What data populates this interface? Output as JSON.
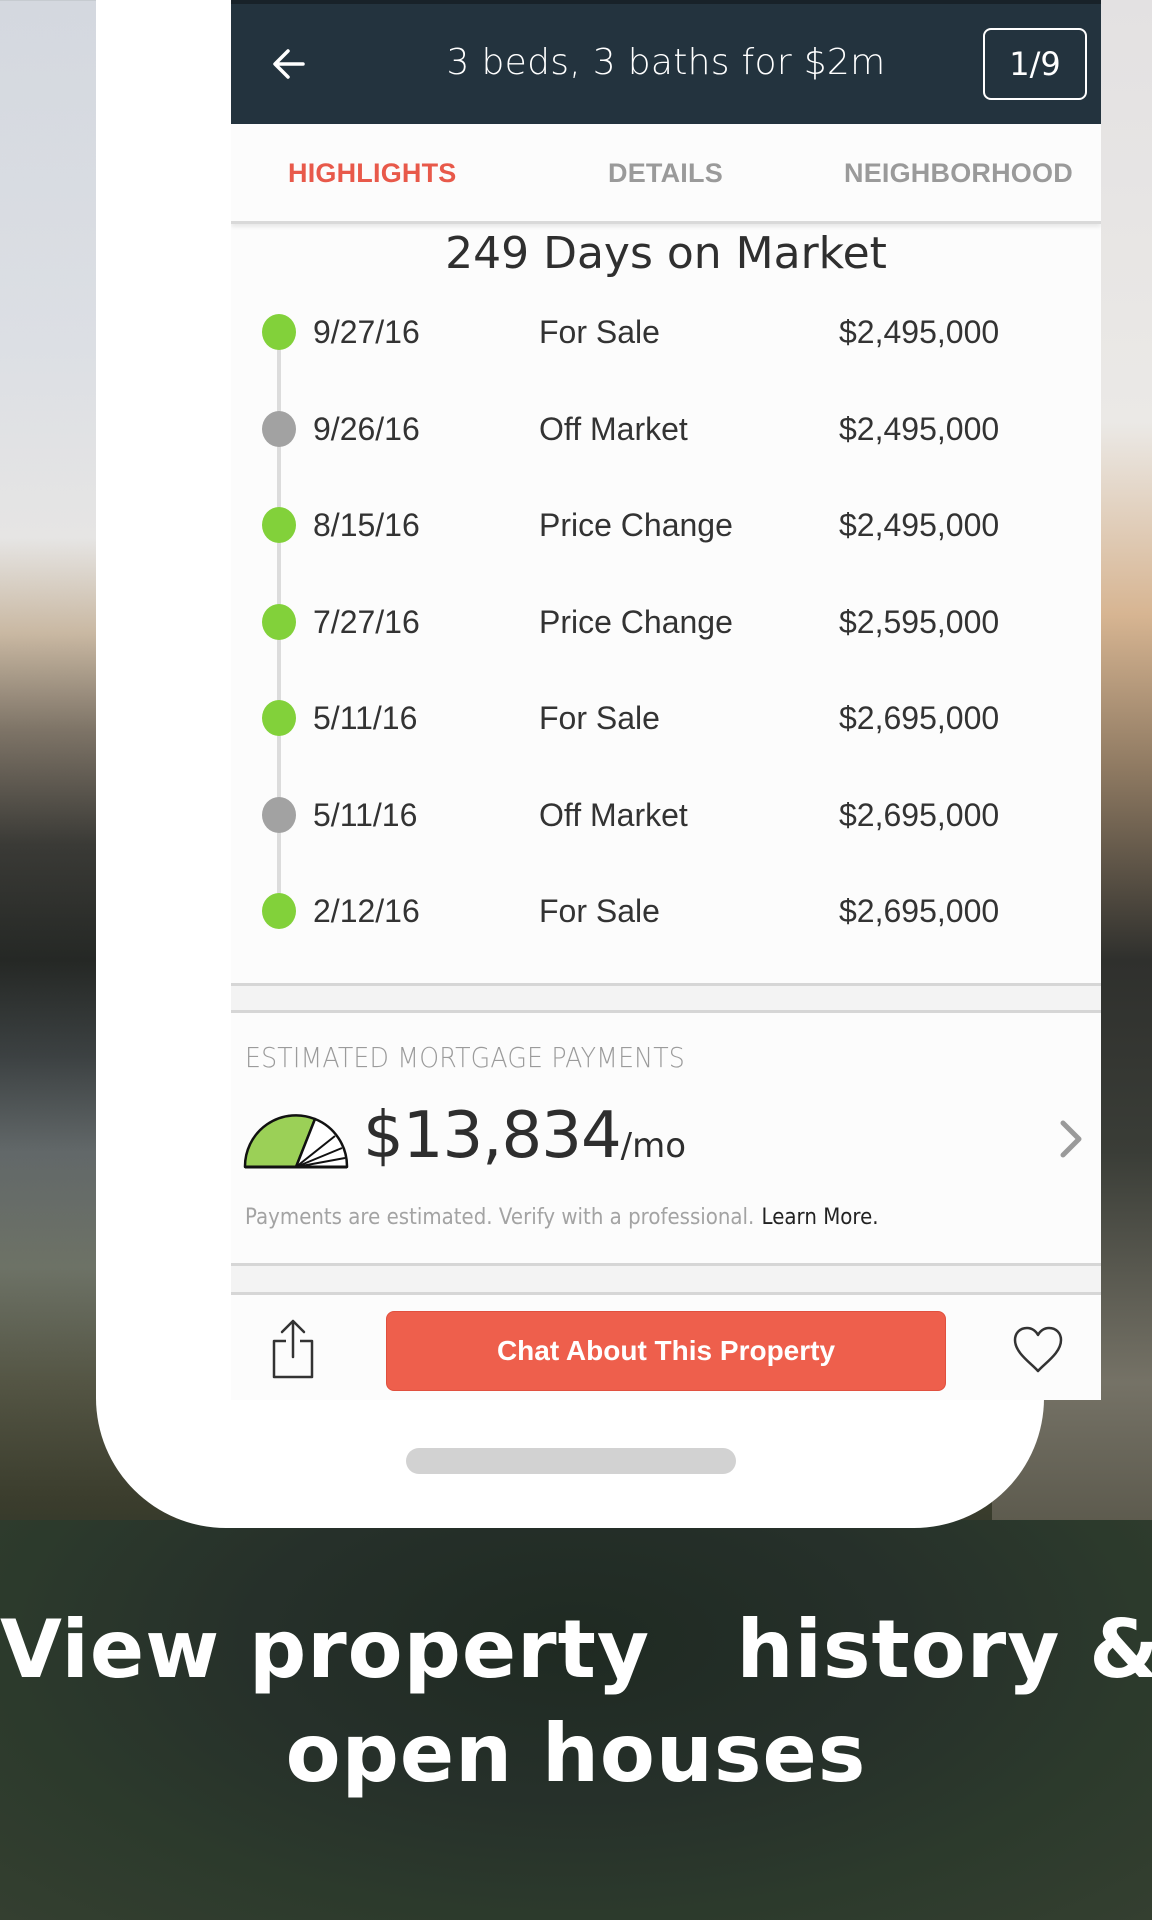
{
  "header": {
    "title": "3 beds, 3 baths for $2m",
    "counter": "1/9",
    "back_icon": "arrow-left-icon"
  },
  "tabs": [
    {
      "label": "HIGHLIGHTS",
      "active": true
    },
    {
      "label": "DETAILS",
      "active": false
    },
    {
      "label": "NEIGHBORHOOD",
      "active": false
    }
  ],
  "history": {
    "title": "249 Days on Market",
    "events": [
      {
        "date": "9/27/16",
        "event": "For Sale",
        "price": "$2,495,000",
        "status": "green"
      },
      {
        "date": "9/26/16",
        "event": "Off Market",
        "price": "$2,495,000",
        "status": "gray"
      },
      {
        "date": "8/15/16",
        "event": "Price Change",
        "price": "$2,495,000",
        "status": "green"
      },
      {
        "date": "7/27/16",
        "event": "Price Change",
        "price": "$2,595,000",
        "status": "green"
      },
      {
        "date": "5/11/16",
        "event": "For Sale",
        "price": "$2,695,000",
        "status": "green"
      },
      {
        "date": "5/11/16",
        "event": "Off Market",
        "price": "$2,695,000",
        "status": "gray"
      },
      {
        "date": "2/12/16",
        "event": "For Sale",
        "price": "$2,695,000",
        "status": "green"
      }
    ]
  },
  "mortgage": {
    "heading": "ESTIMATED MORTGAGE PAYMENTS",
    "amount": "$13,834",
    "suffix": "/mo",
    "disclaimer": "Payments are estimated. Verify with a professional.",
    "learn_more": "Learn More.",
    "gauge_icon": "payment-gauge-icon",
    "chevron_icon": "chevron-right-icon"
  },
  "actions": {
    "chat_label": "Chat About This Property",
    "share_icon": "share-icon",
    "favorite_icon": "heart-icon"
  },
  "caption": {
    "line1": "View property   history &",
    "line2": "open houses"
  },
  "colors": {
    "header_bg": "#23333e",
    "accent": "#ee5f4c",
    "active_tab": "#e8594a",
    "status_green": "#82d13a",
    "status_gray": "#a2a2a2",
    "gauge_fill": "#9bd057"
  }
}
